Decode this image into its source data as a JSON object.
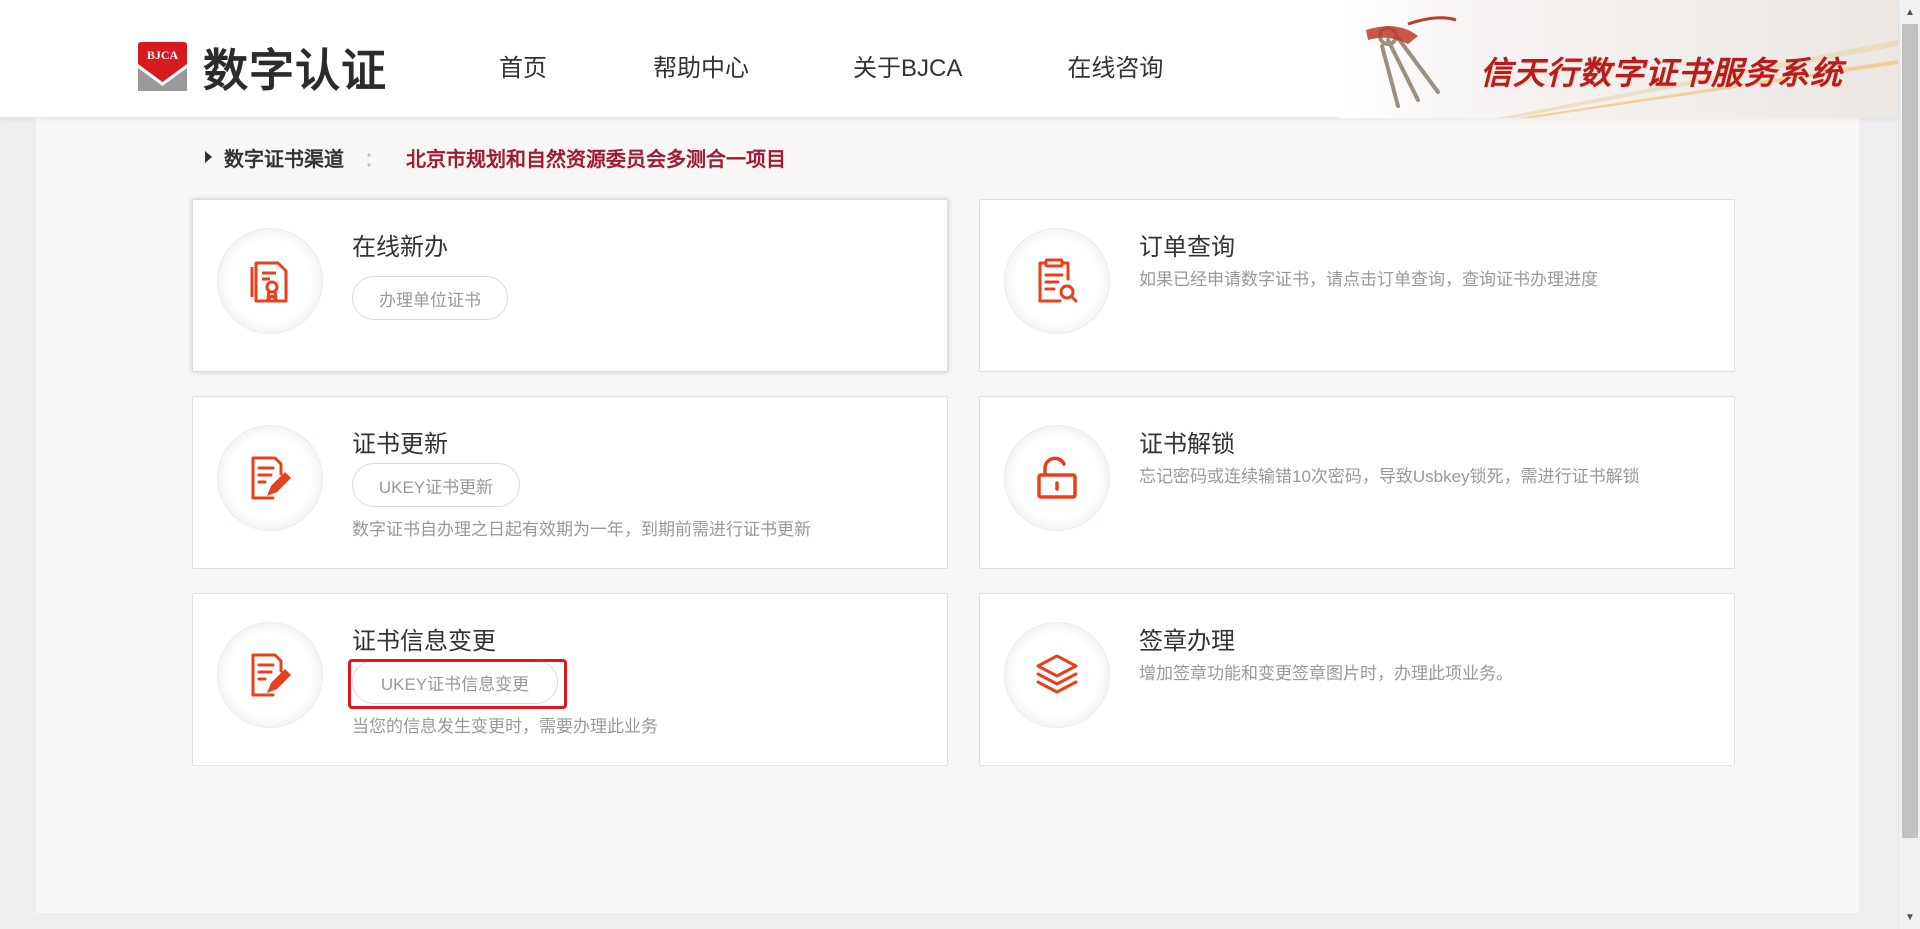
{
  "header": {
    "logo_badge_text": "BJCA",
    "logo_text": "数字认证",
    "nav": [
      "首页",
      "帮助中心",
      "关于BJCA",
      "在线咨询"
    ],
    "banner_title": "信天行数字证书服务系统"
  },
  "channel": {
    "label": "数字证书渠道",
    "separator": "：",
    "value": "北京市规划和自然资源委员会多测合一项目"
  },
  "cards": [
    {
      "title": "在线新办",
      "button": "办理单位证书",
      "desc": "",
      "icon": "certificate-doc-icon"
    },
    {
      "title": "订单查询",
      "button": "",
      "desc": "如果已经申请数字证书，请点击订单查询，查询证书办理进度",
      "icon": "order-search-icon"
    },
    {
      "title": "证书更新",
      "button": "UKEY证书更新",
      "desc": "数字证书自办理之日起有效期为一年，到期前需进行证书更新",
      "icon": "edit-document-icon"
    },
    {
      "title": "证书解锁",
      "button": "",
      "desc": "忘记密码或连续输错10次密码，导致Usbkey锁死，需进行证书解锁",
      "icon": "unlock-icon"
    },
    {
      "title": "证书信息变更",
      "button": "UKEY证书信息变更",
      "desc": "当您的信息发生变更时，需要办理此业务",
      "icon": "edit-document-icon"
    },
    {
      "title": "签章办理",
      "button": "",
      "desc": "增加签章功能和变更签章图片时，办理此项业务。",
      "icon": "layers-icon"
    }
  ],
  "colors": {
    "accent": "#e8401c",
    "channel_value": "#a11a33",
    "highlight": "#e8141c",
    "banner_title": "#b81c1c"
  }
}
